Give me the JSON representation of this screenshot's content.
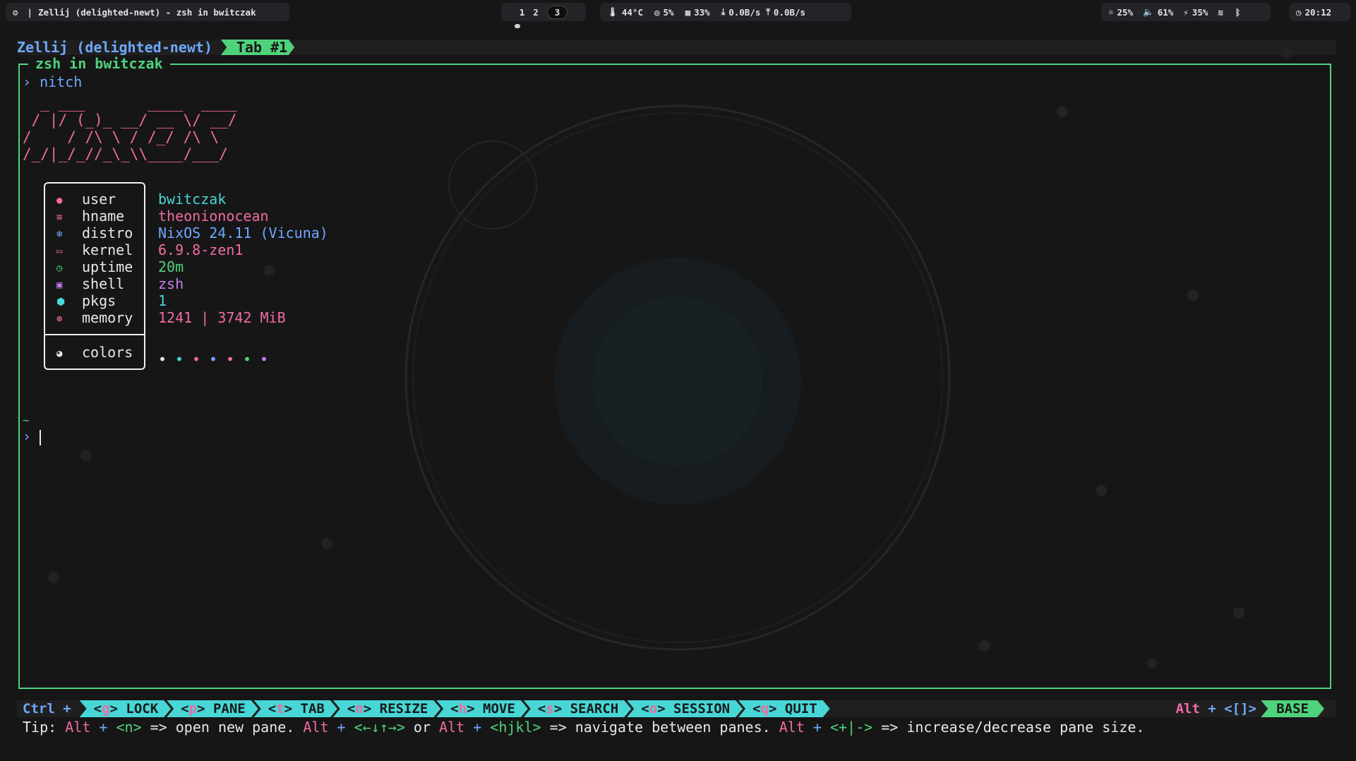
{
  "topbar": {
    "title": "Zellij (delighted-newt) - zsh in bwitczak",
    "workspaces": [
      "1",
      "2",
      "3"
    ],
    "active_workspace": "3",
    "temp": "44°C",
    "cpu": "5%",
    "ram": "33%",
    "down": "0.0B/s",
    "up": "0.0B/s",
    "brightness": "25%",
    "volume": "61%",
    "battery": "35%",
    "clock": "20:12"
  },
  "zellij": {
    "session": "Zellij (delighted-newt)",
    "tab": "Tab #1",
    "pane_title": "zsh in bwitczak"
  },
  "terminal": {
    "prompt_symbol": "›",
    "command": "nitch",
    "ascii_art": "  _ ___       ____  ____\n / |/ (_)_ __/ __ \\/ __/\n/    / /\\ \\ / /_/ /\\ \\\n/_/|_/_//_\\_\\\\____/___/",
    "tilde": "~",
    "colors_label": "colors",
    "color_dots": [
      "#e8e8e8",
      "#48d6d6",
      "#f06ba4",
      "#6fa8ff",
      "#f06ba4",
      "#4fd27c",
      "#c87cf0"
    ]
  },
  "info": [
    {
      "key": "user",
      "value": "bwitczak",
      "color": "#48d6d6",
      "icon": "user-icon",
      "icon_color": "#f06ba4"
    },
    {
      "key": "hname",
      "value": "theonionocean",
      "color": "#f06ba4",
      "icon": "hostname-icon",
      "icon_color": "#f06ba4"
    },
    {
      "key": "distro",
      "value": "NixOS 24.11 (Vicuna)",
      "color": "#6fa8ff",
      "icon": "distro-icon",
      "icon_color": "#6fa8ff"
    },
    {
      "key": "kernel",
      "value": "6.9.8-zen1",
      "color": "#f06ba4",
      "icon": "kernel-icon",
      "icon_color": "#f06ba4"
    },
    {
      "key": "uptime",
      "value": "20m",
      "color": "#4fd27c",
      "icon": "clock-icon",
      "icon_color": "#4fd27c"
    },
    {
      "key": "shell",
      "value": "zsh",
      "color": "#c87cf0",
      "icon": "terminal-icon",
      "icon_color": "#c87cf0"
    },
    {
      "key": "pkgs",
      "value": "1",
      "color": "#48d6d6",
      "icon": "package-icon",
      "icon_color": "#48d6d6"
    },
    {
      "key": "memory",
      "value": "1241 | 3742 MiB",
      "color": "#f06ba4",
      "icon": "memory-icon",
      "icon_color": "#f06ba4"
    }
  ],
  "statusbar": {
    "ctrl": "Ctrl +",
    "modes": [
      {
        "pre": "<",
        "hot": "g",
        "post": "> LOCK"
      },
      {
        "pre": "<",
        "hot": "p",
        "post": "> PANE"
      },
      {
        "pre": "<",
        "hot": "t",
        "post": "> TAB"
      },
      {
        "pre": "<",
        "hot": "n",
        "post": "> RESIZE"
      },
      {
        "pre": "<",
        "hot": "h",
        "post": "> MOVE"
      },
      {
        "pre": "<",
        "hot": "s",
        "post": "> SEARCH"
      },
      {
        "pre": "<",
        "hot": "o",
        "post": "> SESSION"
      },
      {
        "pre": "<",
        "hot": "q",
        "post": "> QUIT"
      }
    ],
    "alt": "Alt",
    "alt_plus": " + <[]>",
    "base": "BASE"
  },
  "tip": {
    "prefix": "Tip: ",
    "alt1": "Alt",
    "plus1": " + ",
    "key1": "<n>",
    "text1": " => open new pane. ",
    "alt2": "Alt",
    "plus2": " + ",
    "key2": "<←↓↑→>",
    "text2": " or ",
    "alt3": "Alt",
    "plus3": " + ",
    "key3": "<hjkl>",
    "text3": " => navigate between panes. ",
    "alt4": "Alt",
    "plus4": " + ",
    "key4": "<+|->",
    "text4": " => increase/decrease pane size."
  }
}
